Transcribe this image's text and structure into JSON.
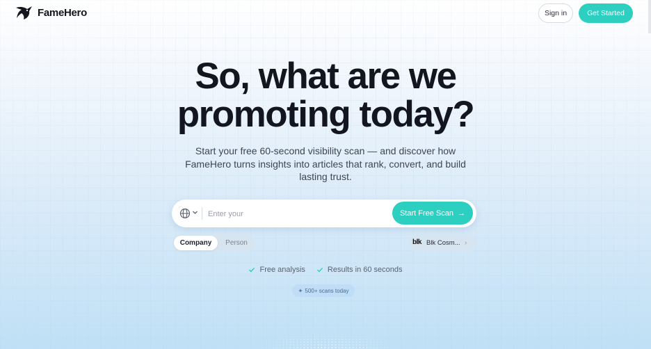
{
  "header": {
    "brand": "FameHero",
    "signin_label": "Sign in",
    "get_started_label": "Get Started"
  },
  "hero": {
    "title_line1": "So, what are we",
    "title_line2": "promoting today?",
    "subtitle": "Start your free 60-second visibility scan — and discover how FameHero turns insights into articles that rank, convert, and build lasting trust."
  },
  "search": {
    "placeholder": "Enter your",
    "scan_label": "Start Free Scan",
    "scan_arrow": "→"
  },
  "toggle": {
    "options": [
      "Company",
      "Person"
    ],
    "selected": "Company"
  },
  "example": {
    "logo_text": "blk",
    "label": "Blk Cosm...",
    "chevron": "›"
  },
  "features": [
    {
      "icon": "check-icon",
      "label": "Free analysis"
    },
    {
      "icon": "check-icon",
      "label": "Results in 60 seconds"
    }
  ],
  "badge": {
    "icon": "sparkle-icon",
    "label": "500+ scans today"
  },
  "colors": {
    "accent": "#2ccfc0",
    "text": "#14161f"
  }
}
